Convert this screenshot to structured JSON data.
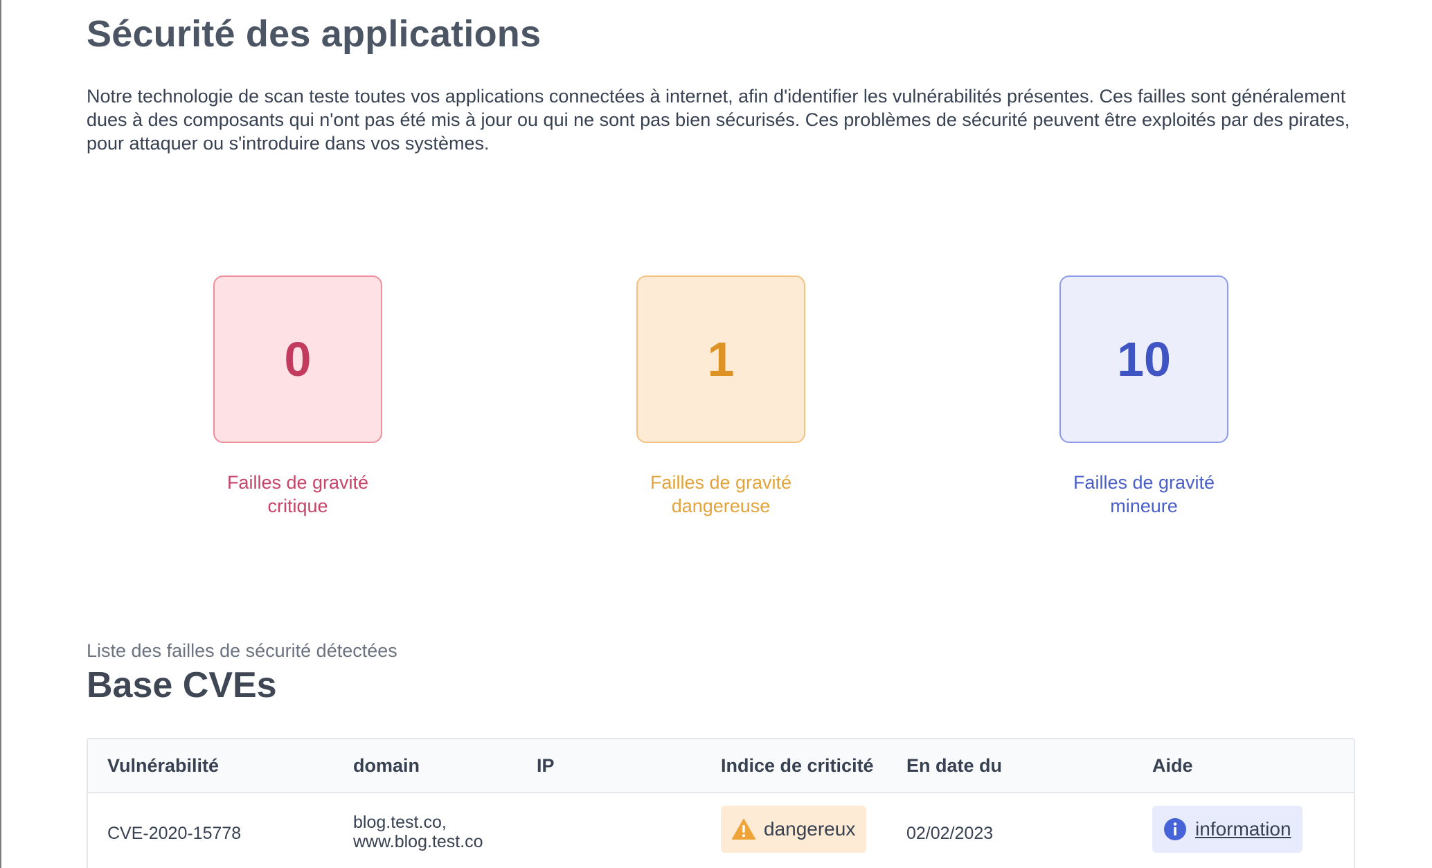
{
  "page": {
    "title": "Sécurité des applications",
    "intro": "Notre technologie de scan teste toutes vos applications connectées à internet, afin d'identifier les vulnérabilités présentes. Ces failles sont généralement dues à des composants qui n'ont pas été mis à jour ou qui ne sont pas bien sécurisés. Ces problèmes de sécurité peuvent être exploités par des pirates, pour attaquer ou s'introduire dans vos systèmes."
  },
  "stats": {
    "critical": {
      "count": "0",
      "label_line1": "Failles de gravité",
      "label_line2": "critique",
      "color": "#c23b5e"
    },
    "dangerous": {
      "count": "1",
      "label_line1": "Failles de gravité",
      "label_line2": "dangereuse",
      "color": "#dd9324"
    },
    "minor": {
      "count": "10",
      "label_line1": "Failles de gravité",
      "label_line2": "mineure",
      "color": "#3f55c4"
    }
  },
  "list": {
    "subtitle": "Liste des failles de sécurité détectées",
    "title": "Base CVEs"
  },
  "table": {
    "headers": {
      "vulnerability": "Vulnérabilité",
      "domain": "domain",
      "ip": "IP",
      "criticality": "Indice de criticité",
      "date": "En date du",
      "help": "Aide"
    },
    "rows": [
      {
        "cve": "CVE-2020-15778",
        "domain_line1": "blog.test.co,",
        "domain_line2": "www.blog.test.co",
        "ip": "",
        "criticality": "dangereux",
        "criticality_icon": "warning-icon",
        "date": "02/02/2023",
        "help_label": "information",
        "help_icon": "info-icon"
      }
    ]
  }
}
